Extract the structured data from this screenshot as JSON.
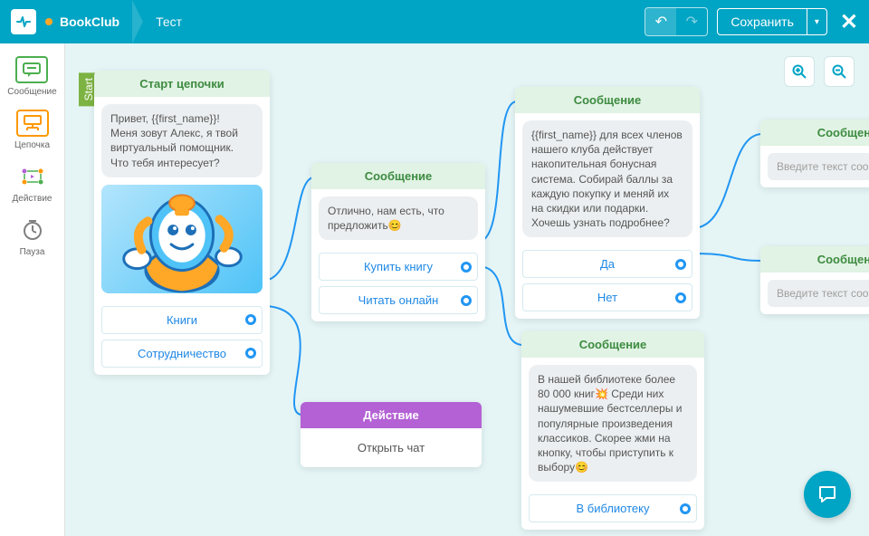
{
  "header": {
    "project": "BookClub",
    "page": "Тест",
    "save": "Сохранить"
  },
  "palette": {
    "message": "Сообщение",
    "chain": "Цепочка",
    "action": "Действие",
    "pause": "Пауза"
  },
  "start_tag": "Start",
  "nodes": {
    "start": {
      "title": "Старт цепочки",
      "text": "Привет, {{first_name}}!\nМеня зовут Алекс, я твой виртуальный помощник. Что тебя интересует?",
      "options": [
        "Книги",
        "Сотрудничество"
      ]
    },
    "n1": {
      "title": "Сообщение",
      "text": "Отлично, нам есть, что предложить😊",
      "options": [
        "Купить книгу",
        "Читать онлайн"
      ]
    },
    "n2": {
      "title": "Сообщение",
      "text": "{{first_name}} для всех членов нашего клуба действует накопительная бонусная система. Собирай баллы за каждую покупку и меняй их на скидки или подарки. Хочешь узнать подробнее?",
      "options": [
        "Да",
        "Нет"
      ]
    },
    "nAction": {
      "title": "Действие",
      "text": "Открыть чат"
    },
    "n3": {
      "title": "Сообщение",
      "text": "В нашей библиотеке более 80 000 книг💥 Среди них нашумевшие бестселлеры и популярные произведения классиков. Скорее жми на кнопку, чтобы приступить к выбору😊",
      "options": [
        "В библиотеку"
      ]
    },
    "n4": {
      "title": "Сообщение",
      "placeholder": "Введите текст сообщения"
    },
    "n5": {
      "title": "Сообщение",
      "placeholder": "Введите текст сообщения"
    }
  }
}
